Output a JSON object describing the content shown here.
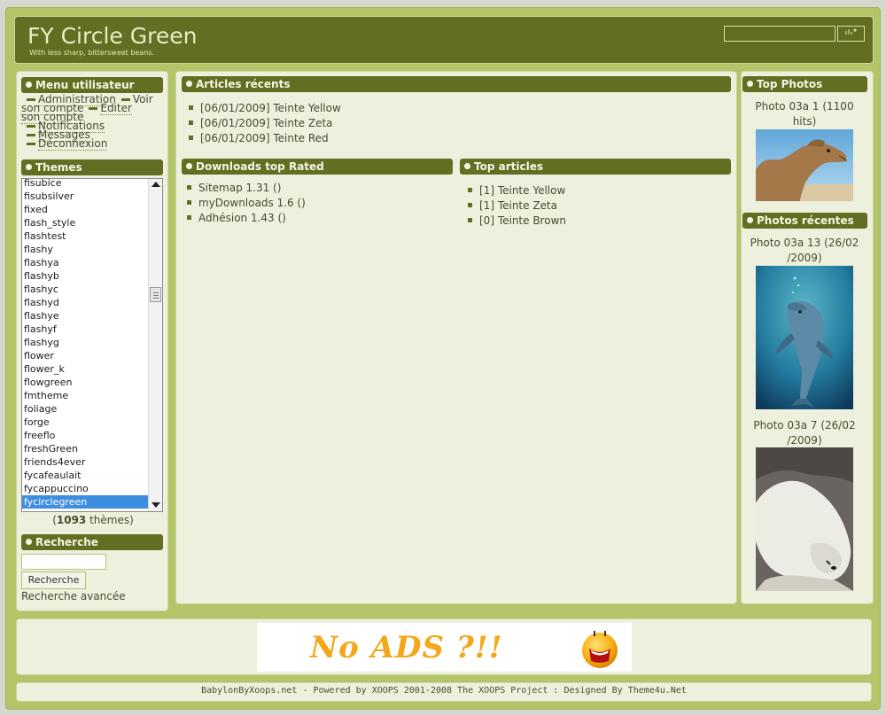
{
  "header": {
    "site_title": "FY Circle Green",
    "slogan": "With less sharp, bittersweet beans.",
    "search_button": "…"
  },
  "user_menu": {
    "title": "Menu utilisateur",
    "items": [
      "Administration",
      "Voir son compte",
      "Editer son compte",
      "Notifications",
      "Messages",
      "Déconnexion"
    ]
  },
  "themes": {
    "title": "Themes",
    "items": [
      "fisubice",
      "fisubsilver",
      "fixed",
      "flash_style",
      "flashtest",
      "flashy",
      "flashya",
      "flashyb",
      "flashyc",
      "flashyd",
      "flashye",
      "flashyf",
      "flashyg",
      "flower",
      "flower_k",
      "flowgreen",
      "fmtheme",
      "foliage",
      "forge",
      "freeflo",
      "freshGreen",
      "friends4ever",
      "fycafeaulait",
      "fycappuccino",
      "fycirclegreen"
    ],
    "selected": "fycirclegreen",
    "count": "1093",
    "count_suffix": " thèmes)",
    "count_prefix": "("
  },
  "search": {
    "title": "Recherche",
    "button": "Recherche",
    "advanced": "Recherche avancée"
  },
  "recent_articles": {
    "title": "Articles récents",
    "items": [
      "[06/01/2009] Teinte Yellow",
      "[06/01/2009] Teinte Zeta",
      "[06/01/2009] Teinte Red"
    ]
  },
  "downloads": {
    "title": "Downloads top Rated",
    "items": [
      "Sitemap 1.31 ()",
      "myDownloads 1.6 ()",
      "Adhésion 1.43 ()"
    ]
  },
  "top_articles": {
    "title": "Top articles",
    "items": [
      "[1] Teinte Yellow",
      "[1] Teinte Zeta",
      "[0] Teinte Brown"
    ]
  },
  "top_photos": {
    "title": "Top Photos",
    "caption_line1": "Photo 03a 1 (1100",
    "caption_line2": "hits)",
    "photo_subject": "camel"
  },
  "recent_photos": {
    "title": "Photos récentes",
    "photos": [
      {
        "caption_line1": "Photo 03a 13 (26/02",
        "caption_line2": "/2009)",
        "subject": "dolphin"
      },
      {
        "caption_line1": "Photo 03a 7 (26/02",
        "caption_line2": "/2009)",
        "subject": "polar-bear"
      }
    ]
  },
  "banner": {
    "text": "No ADS ?!!"
  },
  "footer": {
    "text": "BabylonByXoops.net - Powered by XOOPS 2001-2008 The XOOPS Project : Designed By Theme4u.Net"
  },
  "colors": {
    "accent": "#646e22",
    "frame": "#b4c468",
    "panel": "#ecf0dc",
    "selected": "#3d8ee0"
  }
}
